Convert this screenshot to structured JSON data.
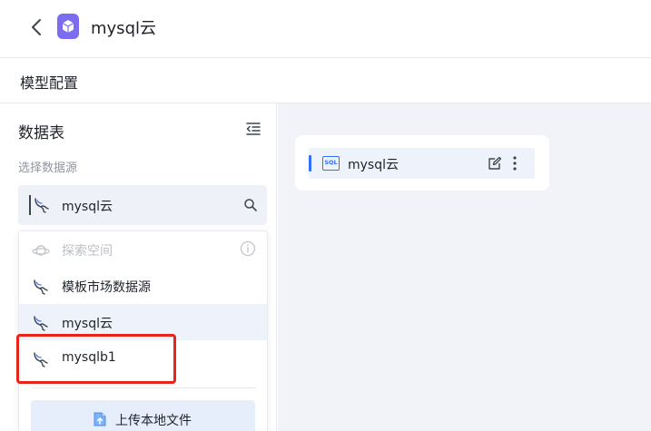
{
  "topbar": {
    "title": "mysql云",
    "back_icon": "chevron-left-icon",
    "app_icon": "box-icon"
  },
  "section": {
    "title": "模型配置"
  },
  "left_panel": {
    "title": "数据表",
    "collapse_icon": "collapse-list-icon",
    "subtitle": "选择数据源",
    "datasource_select": {
      "value": "mysql云",
      "icon": "mysql-dolphin-icon",
      "search_icon": "search-icon"
    },
    "dropdown": {
      "items": [
        {
          "label": "探索空间",
          "disabled": true,
          "icon": "planet-icon"
        },
        {
          "label": "模板市场数据源",
          "icon": "mysql-dolphin-icon"
        },
        {
          "label": "mysql云",
          "selected": true,
          "icon": "mysql-dolphin-icon"
        },
        {
          "label": "mysqlb1",
          "icon": "mysql-dolphin-icon"
        }
      ],
      "upload_label": "上传本地文件"
    }
  },
  "right_panel": {
    "tables": [
      {
        "label": "mysql云",
        "icon_text": "SQL"
      }
    ]
  },
  "colors": {
    "accent": "#3370ff",
    "highlight": "#e8231a",
    "app_icon": "#7b6cf0",
    "panel_bg": "#f1f3f8"
  }
}
